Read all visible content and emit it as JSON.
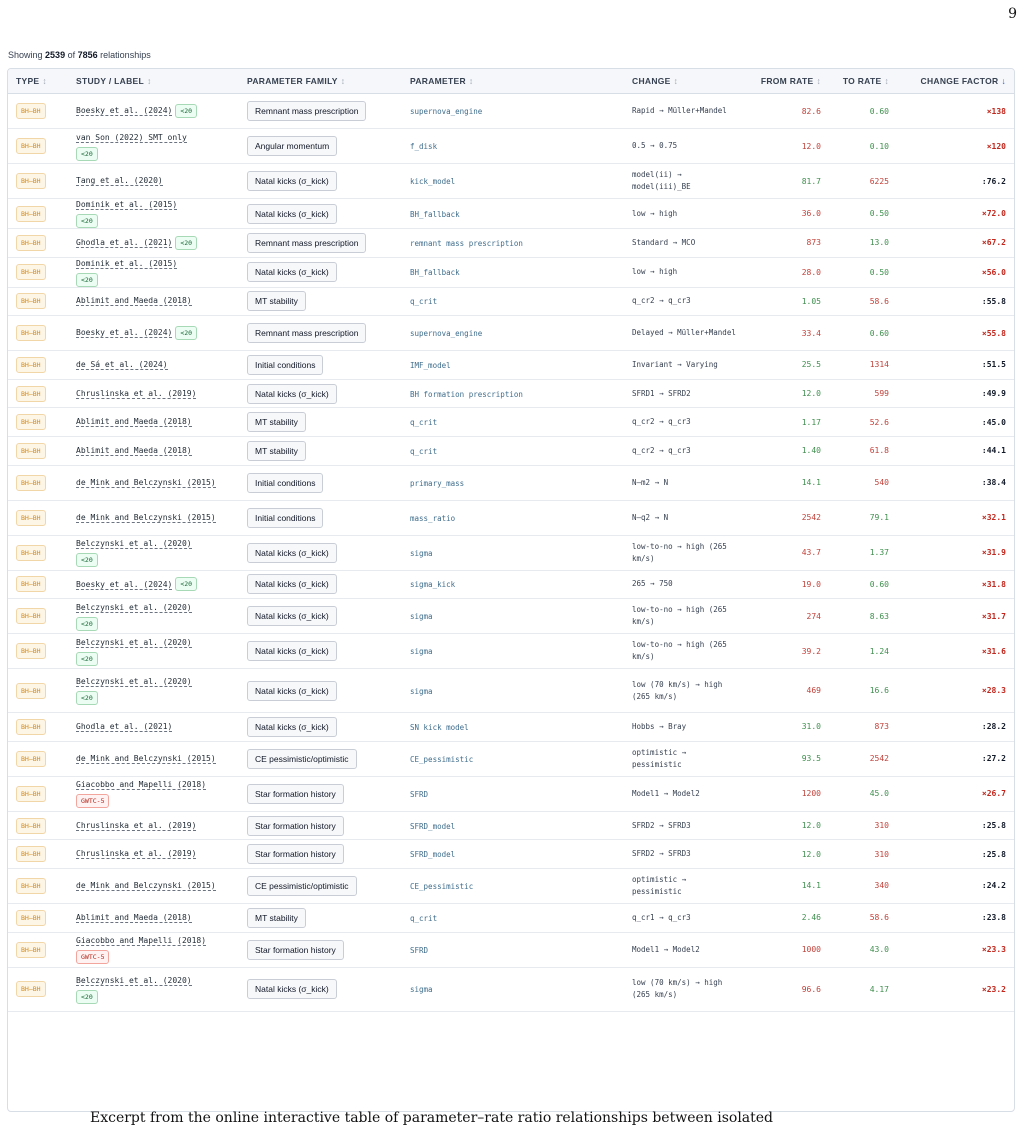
{
  "page_number": "9",
  "summary": {
    "prefix": "Showing",
    "shown": "2539",
    "middle": "of",
    "total": "7856",
    "suffix": "relationships"
  },
  "columns": {
    "type": "TYPE",
    "study": "STUDY / LABEL",
    "family": "PARAMETER FAMILY",
    "parameter": "PARAMETER",
    "change": "CHANGE",
    "from_rate": "FROM RATE",
    "to_rate": "TO RATE",
    "factor": "CHANGE FACTOR",
    "sort_icon": "↕",
    "sort_active_icon": "↓"
  },
  "colors": {
    "type_badge": "#d38c1c",
    "rate_red": "#c2413a",
    "rate_green": "#3f8f4e",
    "factor_red": "#c2261c"
  },
  "rows": [
    {
      "type": "BH–BH",
      "study": "Boesky et al. (2024)",
      "tag": "<20",
      "family": "Remnant mass prescription",
      "parameter": "supernova_engine",
      "change": "Rapid → Müller+Mandel",
      "from": "82.6",
      "to": "0.60",
      "factor": "×138"
    },
    {
      "type": "BH–BH",
      "study": "van Son (2022) SMT only",
      "tag": "<20",
      "family": "Angular momentum",
      "parameter": "f_disk",
      "change": "0.5 → 0.75",
      "from": "12.0",
      "to": "0.10",
      "factor": "×120"
    },
    {
      "type": "BH–BH",
      "study": "Tang et al. (2020)",
      "family": "Natal kicks (σ_kick)",
      "parameter": "kick_model",
      "change": "model(ii) → model(iii)_BE",
      "from": "81.7",
      "to": "6225",
      "factor": ":76.2"
    },
    {
      "type": "BH–BH",
      "study": "Dominik et al. (2015)",
      "tag": "<20",
      "family": "Natal kicks (σ_kick)",
      "parameter": "BH_fallback",
      "change": "low → high",
      "from": "36.0",
      "to": "0.50",
      "factor": "×72.0"
    },
    {
      "type": "BH–BH",
      "study": "Ghodla et al. (2021)",
      "tag": "<20",
      "family": "Remnant mass prescription",
      "parameter": "remnant mass prescription",
      "change": "Standard → MCO",
      "from": "873",
      "to": "13.0",
      "factor": "×67.2"
    },
    {
      "type": "BH–BH",
      "study": "Dominik et al. (2015)",
      "tag": "<20",
      "family": "Natal kicks (σ_kick)",
      "parameter": "BH_fallback",
      "change": "low → high",
      "from": "28.0",
      "to": "0.50",
      "factor": "×56.0"
    },
    {
      "type": "BH–BH",
      "study": "Ablimit and Maeda (2018)",
      "family": "MT stability",
      "parameter": "q_crit",
      "change": "q_cr2 → q_cr3",
      "from": "1.05",
      "to": "58.6",
      "factor": ":55.8"
    },
    {
      "type": "BH–BH",
      "study": "Boesky et al. (2024)",
      "tag": "<20",
      "family": "Remnant mass prescription",
      "parameter": "supernova_engine",
      "change": "Delayed → Müller+Mandel",
      "from": "33.4",
      "to": "0.60",
      "factor": "×55.8"
    },
    {
      "type": "BH–BH",
      "study": "de Sá et al. (2024)",
      "family": "Initial conditions",
      "parameter": "IMF_model",
      "change": "Invariant → Varying",
      "from": "25.5",
      "to": "1314",
      "factor": ":51.5"
    },
    {
      "type": "BH–BH",
      "study": "Chruslinska et al. (2019)",
      "family": "Natal kicks (σ_kick)",
      "parameter": "BH formation prescription",
      "change": "SFRD1 → SFRD2",
      "from": "12.0",
      "to": "599",
      "factor": ":49.9"
    },
    {
      "type": "BH–BH",
      "study": "Ablimit and Maeda (2018)",
      "family": "MT stability",
      "parameter": "q_crit",
      "change": "q_cr2 → q_cr3",
      "from": "1.17",
      "to": "52.6",
      "factor": ":45.0"
    },
    {
      "type": "BH–BH",
      "study": "Ablimit and Maeda (2018)",
      "family": "MT stability",
      "parameter": "q_crit",
      "change": "q_cr2 → q_cr3",
      "from": "1.40",
      "to": "61.8",
      "factor": ":44.1"
    },
    {
      "type": "BH–BH",
      "study": "de Mink and Belczynski (2015)",
      "family": "Initial conditions",
      "parameter": "primary_mass",
      "change": "N–m2 → N",
      "from": "14.1",
      "to": "540",
      "factor": ":38.4"
    },
    {
      "type": "BH–BH",
      "study": "de Mink and Belczynski (2015)",
      "family": "Initial conditions",
      "parameter": "mass_ratio",
      "change": "N–q2 → N",
      "from": "2542",
      "to": "79.1",
      "factor": "×32.1"
    },
    {
      "type": "BH–BH",
      "study": "Belczynski et al. (2020)",
      "tag": "<20",
      "family": "Natal kicks (σ_kick)",
      "parameter": "sigma",
      "change": "low-to-no → high (265 km/s)",
      "from": "43.7",
      "to": "1.37",
      "factor": "×31.9"
    },
    {
      "type": "BH–BH",
      "study": "Boesky et al. (2024)",
      "tag": "<20",
      "family": "Natal kicks (σ_kick)",
      "parameter": "sigma_kick",
      "change": "265 → 750",
      "from": "19.0",
      "to": "0.60",
      "factor": "×31.8"
    },
    {
      "type": "BH–BH",
      "study": "Belczynski et al. (2020)",
      "tag": "<20",
      "family": "Natal kicks (σ_kick)",
      "parameter": "sigma",
      "change": "low-to-no → high (265 km/s)",
      "from": "274",
      "to": "8.63",
      "factor": "×31.7"
    },
    {
      "type": "BH–BH",
      "study": "Belczynski et al. (2020)",
      "tag": "<20",
      "family": "Natal kicks (σ_kick)",
      "parameter": "sigma",
      "change": "low-to-no → high (265 km/s)",
      "from": "39.2",
      "to": "1.24",
      "factor": "×31.6"
    },
    {
      "type": "BH–BH",
      "study": "Belczynski et al. (2020)",
      "tag": "<20",
      "family": "Natal kicks (σ_kick)",
      "parameter": "sigma",
      "change": "low (70 km/s) → high (265 km/s)",
      "from": "469",
      "to": "16.6",
      "factor": "×28.3"
    },
    {
      "type": "BH–BH",
      "study": "Ghodla et al. (2021)",
      "family": "Natal kicks (σ_kick)",
      "parameter": "SN kick model",
      "change": "Hobbs → Bray",
      "from": "31.0",
      "to": "873",
      "factor": ":28.2"
    },
    {
      "type": "BH–BH",
      "study": "de Mink and Belczynski (2015)",
      "family": "CE pessimistic/optimistic",
      "parameter": "CE_pessimistic",
      "change": "optimistic → pessimistic",
      "from": "93.5",
      "to": "2542",
      "factor": ":27.2"
    },
    {
      "type": "BH–BH",
      "study": "Giacobbo and Mapelli (2018)",
      "tag": "GWTC-5",
      "tag_color": "red",
      "family": "Star formation history",
      "parameter": "SFRD",
      "change": "Model1 → Model2",
      "from": "1200",
      "to": "45.0",
      "factor": "×26.7"
    },
    {
      "type": "BH–BH",
      "study": "Chruslinska et al. (2019)",
      "family": "Star formation history",
      "parameter": "SFRD_model",
      "change": "SFRD2 → SFRD3",
      "from": "12.0",
      "to": "310",
      "factor": ":25.8"
    },
    {
      "type": "BH–BH",
      "study": "Chruslinska et al. (2019)",
      "family": "Star formation history",
      "parameter": "SFRD_model",
      "change": "SFRD2 → SFRD3",
      "from": "12.0",
      "to": "310",
      "factor": ":25.8"
    },
    {
      "type": "BH–BH",
      "study": "de Mink and Belczynski (2015)",
      "family": "CE pessimistic/optimistic",
      "parameter": "CE_pessimistic",
      "change": "optimistic → pessimistic",
      "from": "14.1",
      "to": "340",
      "factor": ":24.2"
    },
    {
      "type": "BH–BH",
      "study": "Ablimit and Maeda (2018)",
      "family": "MT stability",
      "parameter": "q_crit",
      "change": "q_cr1 → q_cr3",
      "from": "2.46",
      "to": "58.6",
      "factor": ":23.8"
    },
    {
      "type": "BH–BH",
      "study": "Giacobbo and Mapelli (2018)",
      "tag": "GWTC-5",
      "tag_color": "red",
      "family": "Star formation history",
      "parameter": "SFRD",
      "change": "Model1 → Model2",
      "from": "1000",
      "to": "43.0",
      "factor": "×23.3"
    },
    {
      "type": "BH–BH",
      "study": "Belczynski et al. (2020)",
      "tag": "<20",
      "family": "Natal kicks (σ_kick)",
      "parameter": "sigma",
      "change": "low (70 km/s) → high (265 km/s)",
      "from": "96.6",
      "to": "4.17",
      "factor": "×23.2"
    }
  ],
  "caption": "Excerpt from the online interactive table of parameter–rate ratio relationships between isolated"
}
